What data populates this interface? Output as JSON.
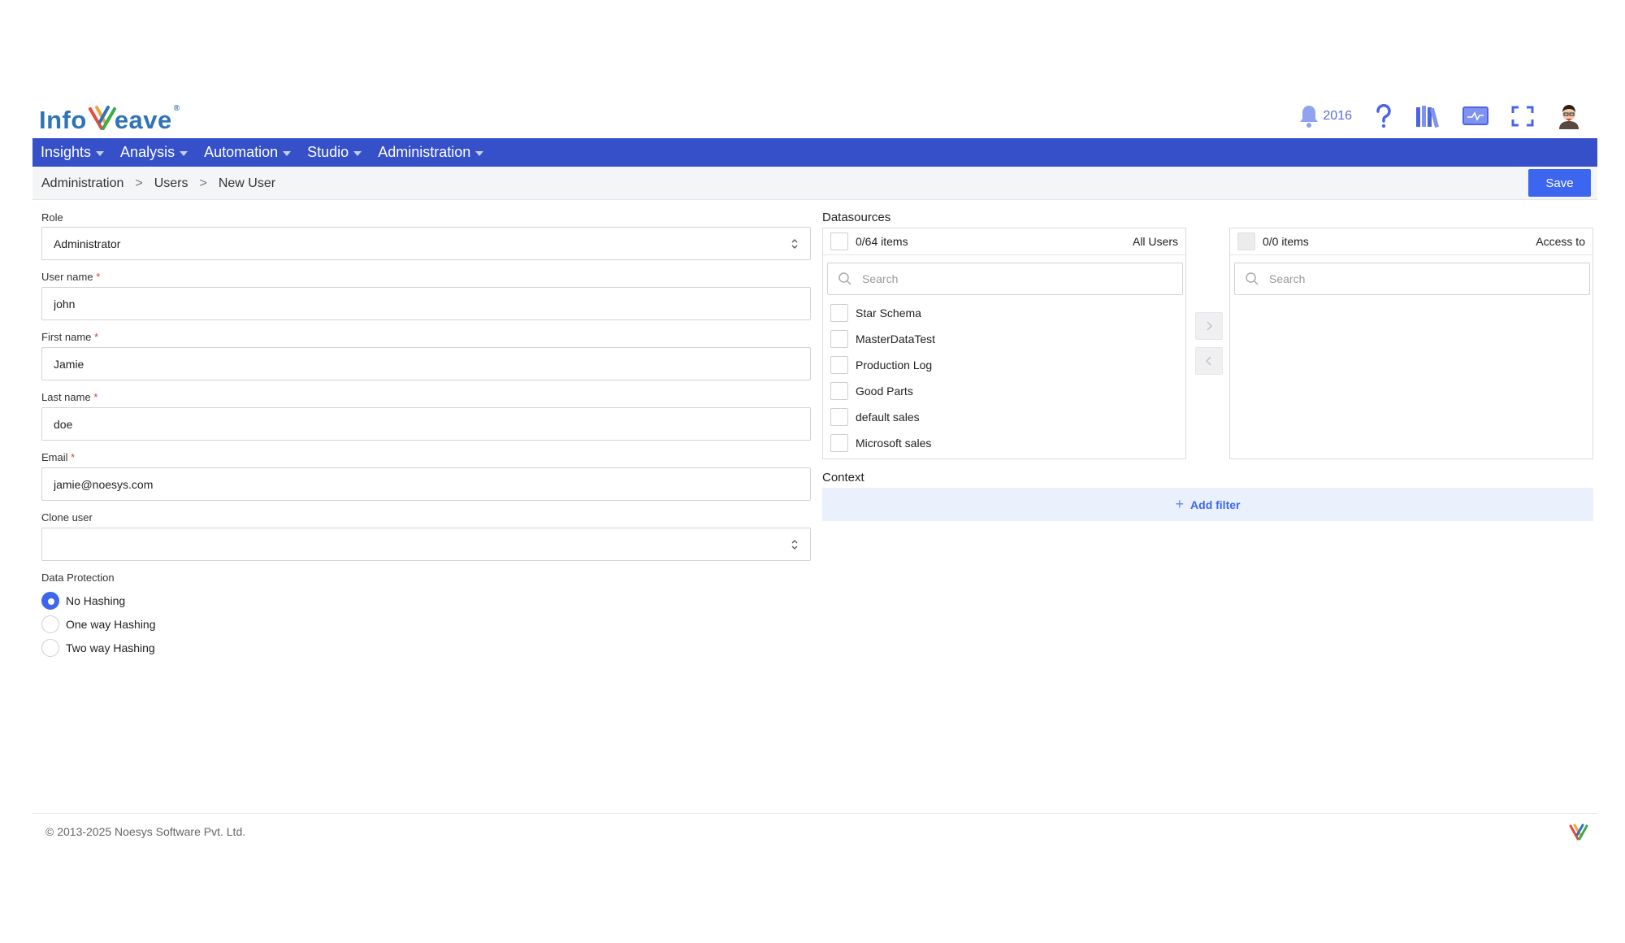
{
  "header": {
    "logo_text_1": "Info",
    "logo_text_2": "eave",
    "logo_reg": "®",
    "notification_count": "2016"
  },
  "nav": {
    "items": [
      {
        "label": "Insights"
      },
      {
        "label": "Analysis"
      },
      {
        "label": "Automation"
      },
      {
        "label": "Studio"
      },
      {
        "label": "Administration"
      }
    ]
  },
  "breadcrumb": {
    "items": [
      "Administration",
      "Users",
      "New User"
    ],
    "separator": ">"
  },
  "toolbar": {
    "save_label": "Save"
  },
  "form": {
    "role_label": "Role",
    "role_value": "Administrator",
    "username_label": "User name",
    "username_value": "john",
    "firstname_label": "First name",
    "firstname_value": "Jamie",
    "lastname_label": "Last name",
    "lastname_value": "doe",
    "email_label": "Email",
    "email_value": "jamie@noesys.com",
    "clone_label": "Clone user",
    "clone_value": "",
    "required_mark": "*",
    "protection_label": "Data Protection",
    "protection_options": [
      {
        "label": "No Hashing",
        "checked": true
      },
      {
        "label": "One way Hashing",
        "checked": false
      },
      {
        "label": "Two way Hashing",
        "checked": false
      }
    ]
  },
  "datasources": {
    "title": "Datasources",
    "left": {
      "count": "0/64 items",
      "title": "All Users",
      "search_placeholder": "Search",
      "items": [
        "Star Schema",
        "MasterDataTest",
        "Production Log",
        "Good Parts",
        "default sales",
        "Microsoft sales"
      ]
    },
    "right": {
      "count": "0/0 items",
      "title": "Access to",
      "search_placeholder": "Search"
    }
  },
  "context": {
    "title": "Context",
    "add_filter_plus": "+",
    "add_filter_label": "Add filter"
  },
  "footer": {
    "copyright": "© 2013-2025 Noesys Software Pvt. Ltd."
  },
  "colors": {
    "nav_bg": "#3550c9",
    "primary": "#3d66f0",
    "filter_bg": "#eaf1fd"
  }
}
